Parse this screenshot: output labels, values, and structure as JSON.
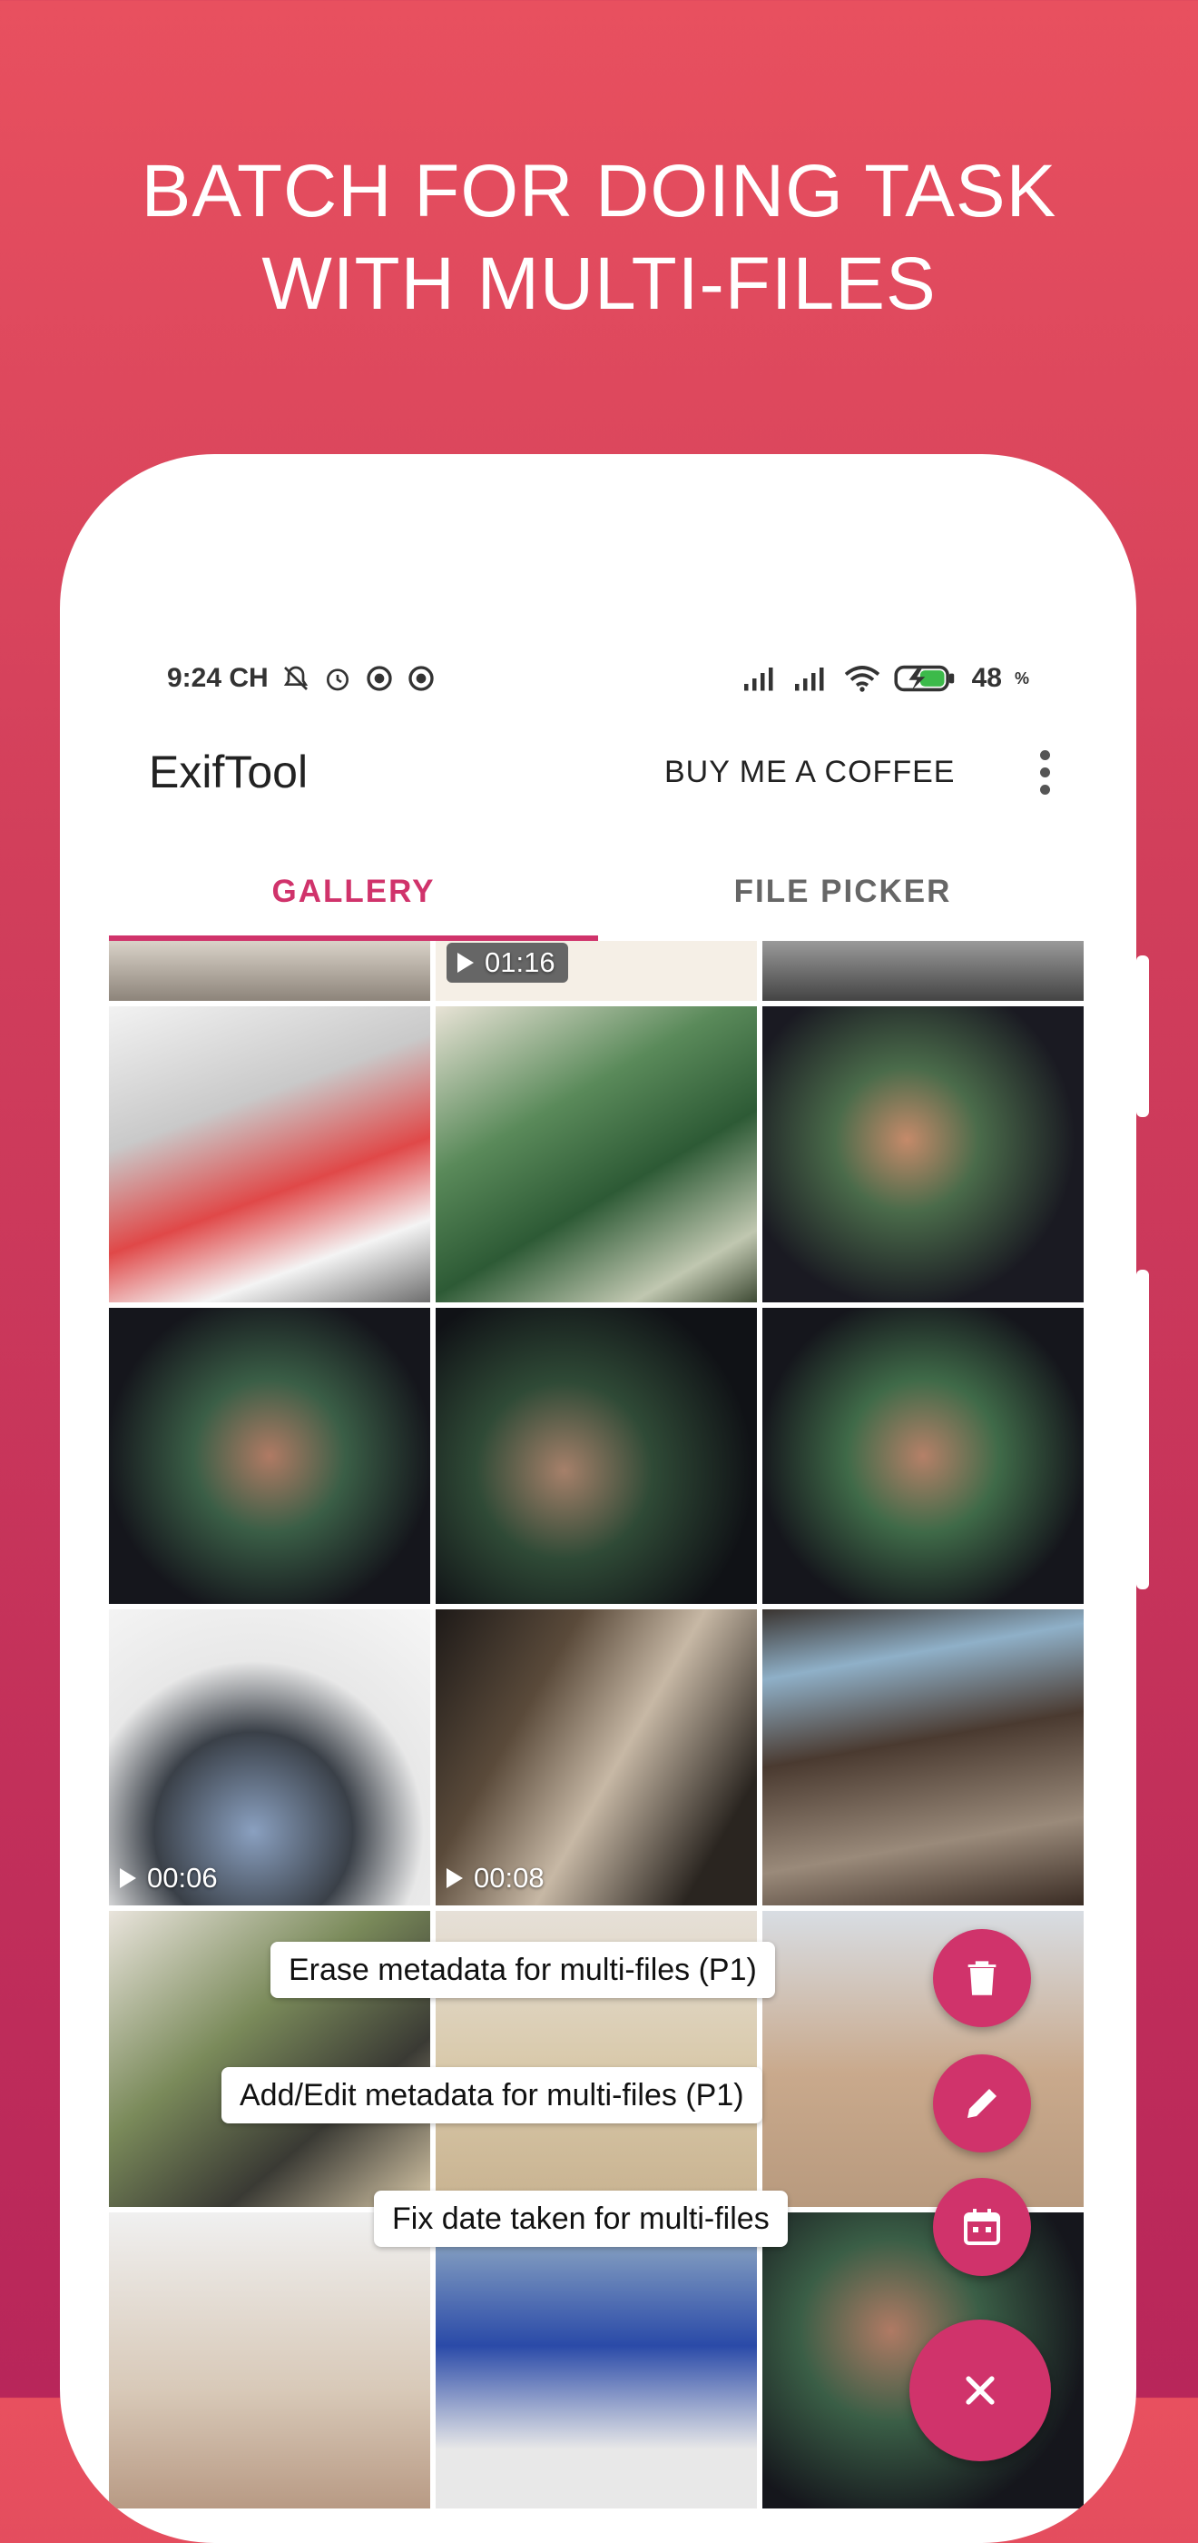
{
  "headline": {
    "line1": "BATCH FOR DOING TASK",
    "line2": "WITH MULTI-FILES"
  },
  "status_bar": {
    "time": "9:24 CH",
    "battery": "48",
    "battery_unit": "%"
  },
  "app_bar": {
    "title": "ExifTool",
    "coffee_label": "BUY ME A COFFEE"
  },
  "tabs": [
    {
      "label": "GALLERY"
    },
    {
      "label": "FILE PICKER"
    }
  ],
  "gallery": {
    "top_video_duration": "01:16",
    "video_durations": [
      "00:06",
      "00:08"
    ]
  },
  "actions": {
    "erase": "Erase metadata for multi-files (P1)",
    "edit": "Add/Edit metadata for multi-files (P1)",
    "fix_date": "Fix date taken for multi-files"
  },
  "colors": {
    "accent": "#d0336b",
    "background_top": "#e8505f",
    "background_bottom": "#b8265a"
  }
}
